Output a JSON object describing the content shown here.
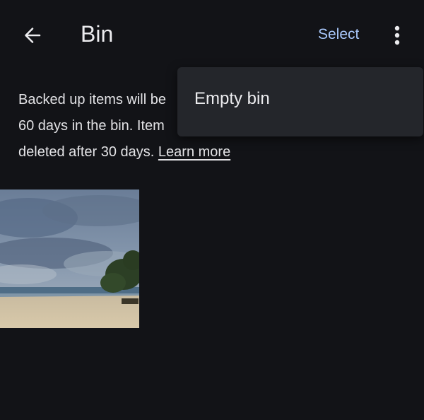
{
  "header": {
    "title": "Bin",
    "back_icon": "arrow-left-icon",
    "select_label": "Select",
    "more_icon": "more-vertical-icon"
  },
  "info": {
    "line1": "Backed up items will be",
    "line2": "60 days in the bin. Item",
    "line3": "deleted after 30 days.",
    "learn_more": "Learn more"
  },
  "menu": {
    "items": [
      {
        "label": "Empty bin"
      }
    ]
  },
  "colors": {
    "background": "#121317",
    "accent": "#a8c7fa",
    "menu_background": "#24262b"
  }
}
